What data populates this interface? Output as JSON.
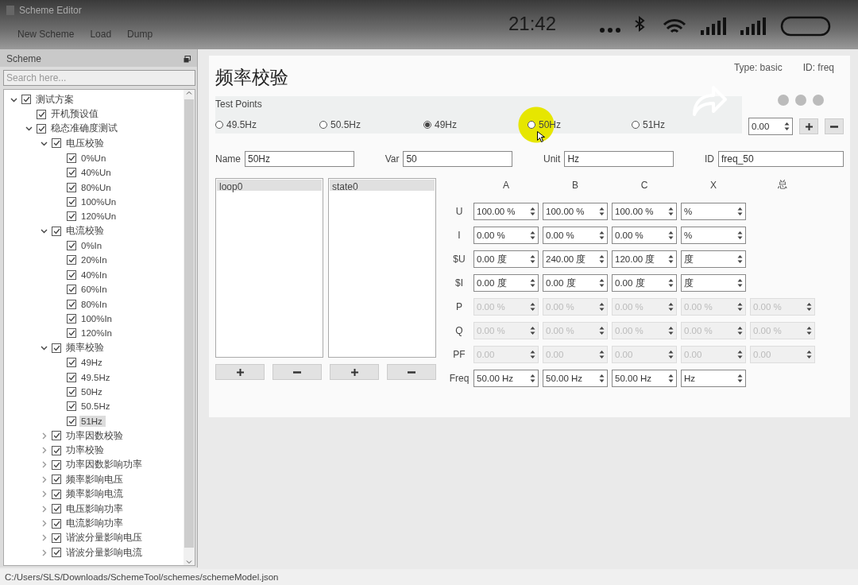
{
  "window": {
    "title": "Scheme Editor"
  },
  "menu": [
    "New Scheme",
    "Load",
    "Dump"
  ],
  "overlay": {
    "time": "21:42"
  },
  "sidebar": {
    "title": "Scheme",
    "search": {
      "placeholder": "Search here..."
    },
    "tree": [
      {
        "label": "测试方案",
        "checked": true,
        "expanded": true,
        "selected": false,
        "children": [
          {
            "label": "开机预设值",
            "checked": true,
            "selected": false
          },
          {
            "label": "稳态准确度测试",
            "checked": true,
            "expanded": true,
            "selected": false,
            "children": [
              {
                "label": "电压校验",
                "checked": true,
                "expanded": true,
                "selected": false,
                "children": [
                  {
                    "label": "0%Un",
                    "checked": true,
                    "selected": false
                  },
                  {
                    "label": "40%Un",
                    "checked": true,
                    "selected": false
                  },
                  {
                    "label": "80%Un",
                    "checked": true,
                    "selected": false
                  },
                  {
                    "label": "100%Un",
                    "checked": true,
                    "selected": false
                  },
                  {
                    "label": "120%Un",
                    "checked": true,
                    "selected": false
                  }
                ]
              },
              {
                "label": "电流校验",
                "checked": true,
                "expanded": true,
                "selected": false,
                "children": [
                  {
                    "label": "0%In",
                    "checked": true,
                    "selected": false
                  },
                  {
                    "label": "20%In",
                    "checked": true,
                    "selected": false
                  },
                  {
                    "label": "40%In",
                    "checked": true,
                    "selected": false
                  },
                  {
                    "label": "60%In",
                    "checked": true,
                    "selected": false
                  },
                  {
                    "label": "80%In",
                    "checked": true,
                    "selected": false
                  },
                  {
                    "label": "100%In",
                    "checked": true,
                    "selected": false
                  },
                  {
                    "label": "120%In",
                    "checked": true,
                    "selected": false
                  }
                ]
              },
              {
                "label": "频率校验",
                "checked": true,
                "expanded": true,
                "selected": false,
                "children": [
                  {
                    "label": "49Hz",
                    "checked": true,
                    "selected": false
                  },
                  {
                    "label": "49.5Hz",
                    "checked": true,
                    "selected": false
                  },
                  {
                    "label": "50Hz",
                    "checked": true,
                    "selected": false
                  },
                  {
                    "label": "50.5Hz",
                    "checked": true,
                    "selected": false
                  },
                  {
                    "label": "51Hz",
                    "checked": true,
                    "selected": true
                  }
                ]
              },
              {
                "label": "功率因数校验",
                "checked": true,
                "expanded": false,
                "selected": false
              },
              {
                "label": "功率校验",
                "checked": true,
                "expanded": false,
                "selected": false
              },
              {
                "label": "功率因数影响功率",
                "checked": true,
                "expanded": false,
                "selected": false
              },
              {
                "label": "频率影响电压",
                "checked": true,
                "expanded": false,
                "selected": false
              },
              {
                "label": "频率影响电流",
                "checked": true,
                "expanded": false,
                "selected": false
              },
              {
                "label": "电压影响功率",
                "checked": true,
                "expanded": false,
                "selected": false
              },
              {
                "label": "电流影响功率",
                "checked": true,
                "expanded": false,
                "selected": false
              },
              {
                "label": "谐波分量影响电压",
                "checked": true,
                "expanded": false,
                "selected": false
              },
              {
                "label": "谐波分量影响电流",
                "checked": true,
                "expanded": false,
                "selected": false
              }
            ]
          }
        ]
      }
    ]
  },
  "editor": {
    "title": "频率校验",
    "type": "Type: basic",
    "id": "ID: freq",
    "test_points": {
      "label": "Test Points",
      "options": [
        {
          "label": "49.5Hz",
          "selected": false
        },
        {
          "label": "50.5Hz",
          "selected": false
        },
        {
          "label": "49Hz",
          "selected": true
        },
        {
          "label": "50Hz",
          "selected": false
        },
        {
          "label": "51Hz",
          "selected": false
        }
      ],
      "spin": "0.00"
    },
    "fields": [
      {
        "label": "Name",
        "value": "50Hz"
      },
      {
        "label": "Var",
        "value": "50"
      },
      {
        "label": "Unit",
        "value": "Hz"
      },
      {
        "label": "ID",
        "value": "freq_50"
      }
    ],
    "lists": [
      {
        "items": [
          {
            "label": "loop0",
            "selected": true
          }
        ]
      },
      {
        "items": [
          {
            "label": "state0",
            "selected": true
          }
        ]
      }
    ],
    "grid": {
      "columns": [
        "A",
        "B",
        "C",
        "X",
        "总"
      ],
      "rows": [
        {
          "label": "U",
          "disabled": false,
          "cells": [
            "100.00 %",
            "100.00 %",
            "100.00 %",
            "%"
          ]
        },
        {
          "label": "I",
          "disabled": false,
          "cells": [
            "0.00 %",
            "0.00 %",
            "0.00 %",
            "%"
          ]
        },
        {
          "label": "$U",
          "disabled": false,
          "cells": [
            "0.00 度",
            "240.00 度",
            "120.00 度",
            "度"
          ]
        },
        {
          "label": "$I",
          "disabled": false,
          "cells": [
            "0.00 度",
            "0.00 度",
            "0.00 度",
            "度"
          ]
        },
        {
          "label": "P",
          "disabled": true,
          "cells": [
            "0.00 %",
            "0.00 %",
            "0.00 %",
            "0.00 %",
            "0.00 %"
          ]
        },
        {
          "label": "Q",
          "disabled": true,
          "cells": [
            "0.00 %",
            "0.00 %",
            "0.00 %",
            "0.00 %",
            "0.00 %"
          ]
        },
        {
          "label": "PF",
          "disabled": true,
          "cells": [
            "0.00",
            "0.00",
            "0.00",
            "0.00",
            "0.00"
          ]
        },
        {
          "label": "Freq",
          "disabled": false,
          "cells": [
            "50.00 Hz",
            "50.00 Hz",
            "50.00 Hz",
            "Hz"
          ]
        }
      ]
    }
  },
  "status_bar": "C:/Users/SLS/Downloads/SchemeTool/schemes/schemeModel.json"
}
